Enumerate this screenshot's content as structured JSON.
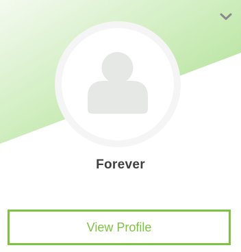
{
  "profile_card": {
    "name": "Forever",
    "view_profile_label": "View Profile",
    "menu_icon": "chevron-down-icon",
    "avatar_icon": "user-placeholder-icon"
  },
  "colors": {
    "accent": "#7dc242",
    "banner_green": "#a8dc8c",
    "name_text": "#3f3f3f",
    "avatar_fill": "#e6e8e6",
    "chevron": "#8a8a8a"
  }
}
